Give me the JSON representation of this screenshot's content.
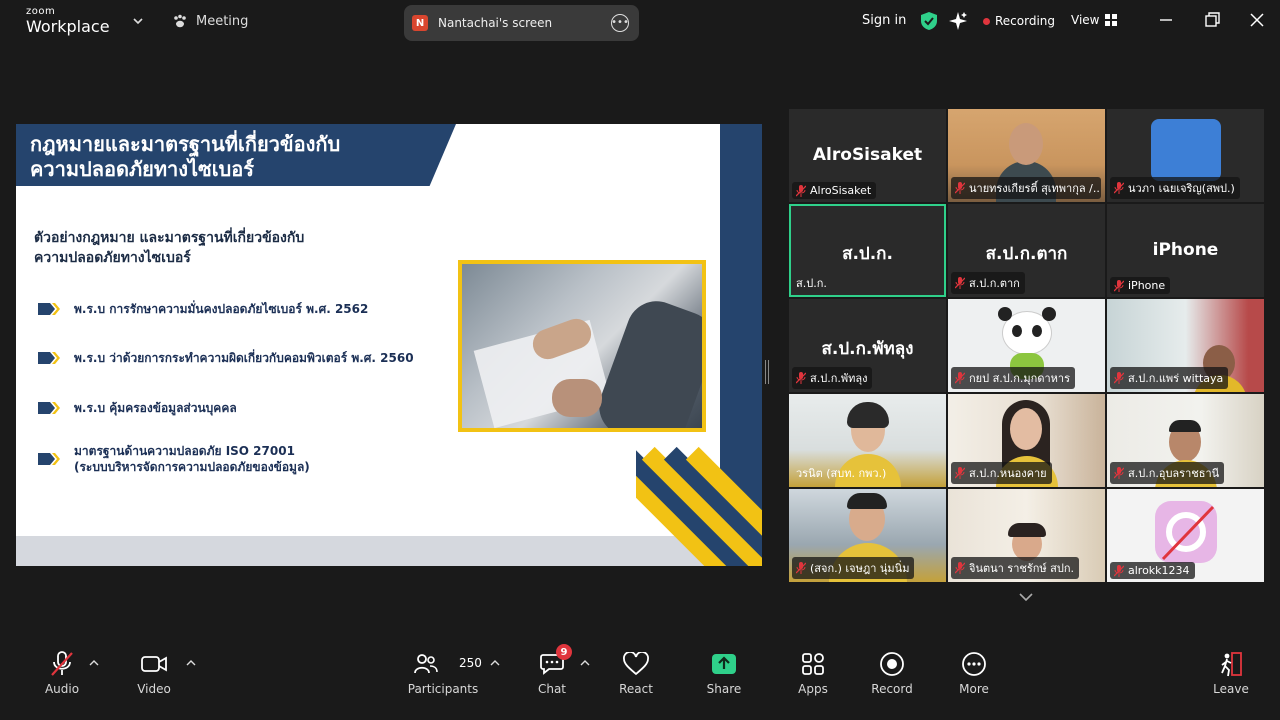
{
  "topbar": {
    "brand_small": "zoom",
    "brand_large": "Workplace",
    "meeting_label": "Meeting",
    "share_badge": "N",
    "sharing_name": "Nantachai's screen",
    "sign_in": "Sign in",
    "recording": "Recording",
    "view": "View",
    "colors": {
      "recording_dot": "#e0353d",
      "shield": "#2fd08a"
    }
  },
  "slide": {
    "title_line1": "กฎหมายและมาตรฐานที่เกี่ยวข้องกับ",
    "title_line2": "ความปลอดภัยทางไซเบอร์",
    "subheading_line1": "ตัวอย่างกฎหมาย และมาตรฐานที่เกี่ยวข้องกับ",
    "subheading_line2": "ความปลอดภัยทางไซเบอร์",
    "bullets": [
      "พ.ร.บ การรักษาความมั่นคงปลอดภัยไซเบอร์ พ.ศ. 2562",
      "พ.ร.บ ว่าด้วยการกระทำความผิดเกี่ยวกับคอมพิวเตอร์ พ.ศ. 2560",
      "พ.ร.บ คุ้มครองข้อมูลส่วนบุคคล",
      "มาตรฐานด้านความปลอดภัย ISO 27001",
      "(ระบบบริหารจัดการความปลอดภัยของข้อมูล)"
    ],
    "colors": {
      "navy": "#25446d",
      "gold": "#f2c214"
    }
  },
  "participants": [
    {
      "big": "AlroSisaket",
      "label": "AlroSisaket"
    },
    {
      "big": "",
      "label": "นายทรงเกียรติ์ สุเทพากุล /..."
    },
    {
      "big": "",
      "label": "นวภา เฉยเจริญ(สพป.)"
    },
    {
      "big": "ส.ป.ก.",
      "label": "ส.ป.ก."
    },
    {
      "big": "ส.ป.ก.ตาก",
      "label": "ส.ป.ก.ตาก"
    },
    {
      "big": "iPhone",
      "label": "iPhone"
    },
    {
      "big": "ส.ป.ก.พัทลุง",
      "label": "ส.ป.ก.พัทลุง"
    },
    {
      "big": "",
      "label": "กยป ส.ป.ก.มุกดาหาร"
    },
    {
      "big": "",
      "label": "ส.ป.ก.แพร่ wittaya"
    },
    {
      "big": "",
      "label": "วรนิต (สบท. กพว.)"
    },
    {
      "big": "",
      "label": "ส.ป.ก.หนองคาย"
    },
    {
      "big": "",
      "label": "ส.ป.ก.อุบลราชธานี"
    },
    {
      "big": "",
      "label": "(สจก.) เจษฎา นุ่มนิ่ม"
    },
    {
      "big": "",
      "label": "จินตนา ราชรักษ์ สปก."
    },
    {
      "big": "",
      "label": "alrokk1234"
    }
  ],
  "toolbar": {
    "audio": "Audio",
    "video": "Video",
    "participants": "Participants",
    "participant_count": "250",
    "chat": "Chat",
    "chat_badge": "9",
    "react": "React",
    "share": "Share",
    "apps": "Apps",
    "record": "Record",
    "more": "More",
    "leave": "Leave",
    "colors": {
      "share_green": "#2fd08a",
      "leave_red": "#e0353d"
    }
  }
}
